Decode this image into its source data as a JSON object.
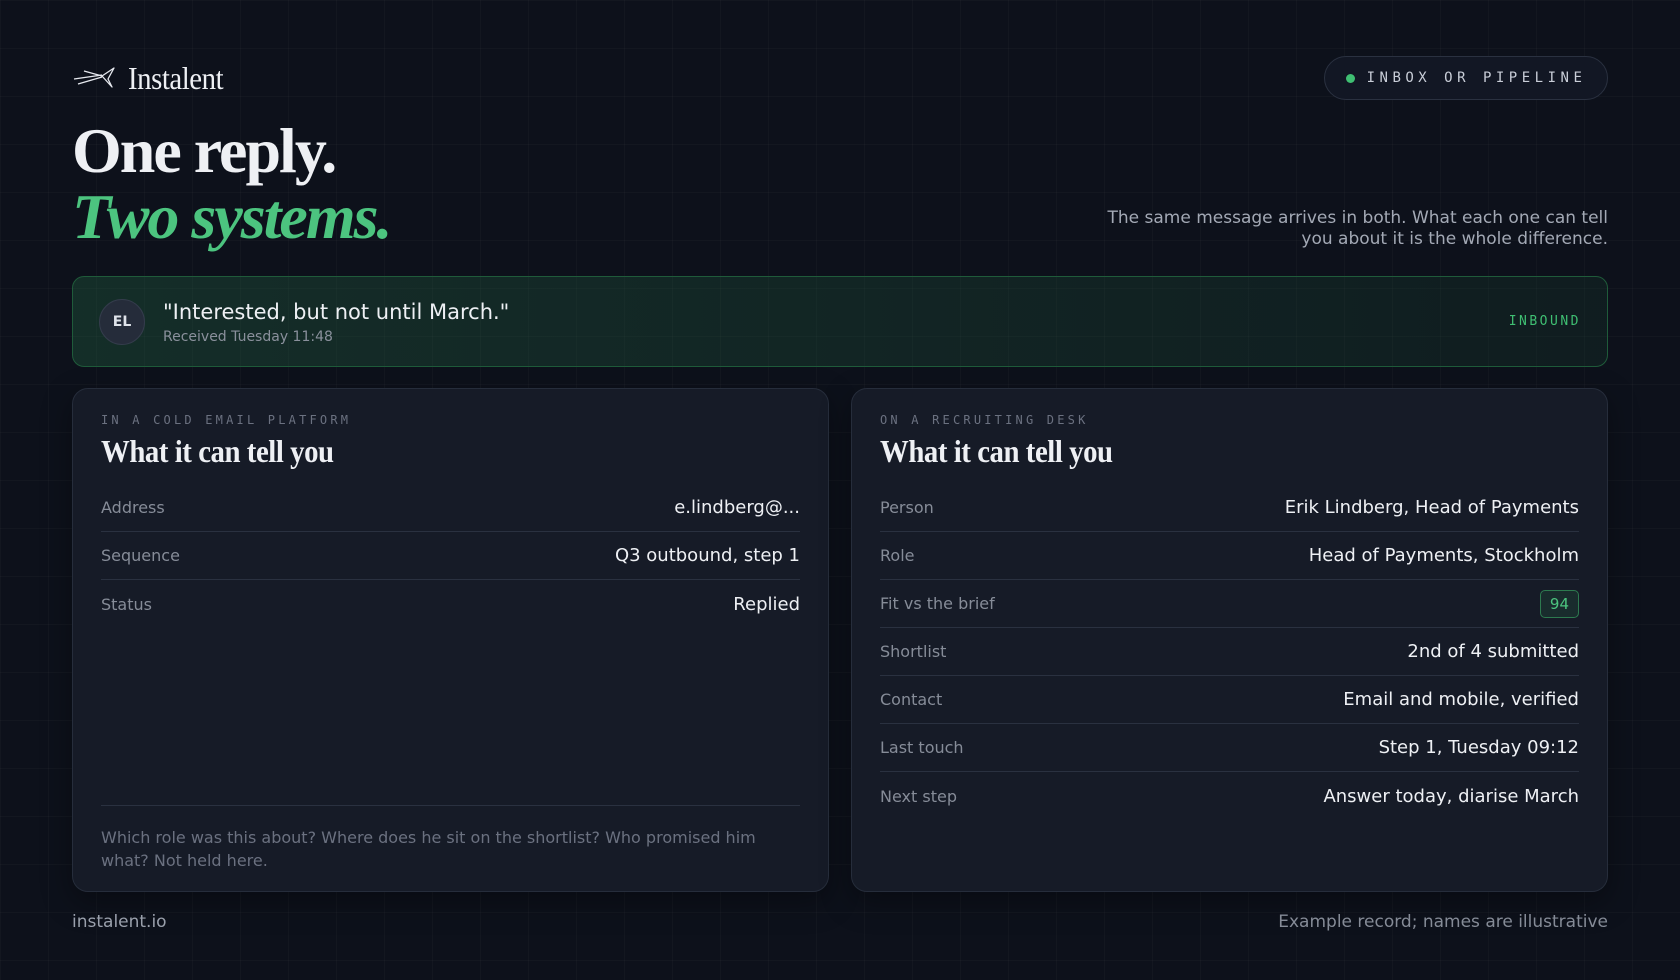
{
  "brand": {
    "name": "Instalent",
    "logo_icon": "sparkle-arrow-icon"
  },
  "header": {
    "pill_label": "INBOX OR PIPELINE",
    "pill_dot_color": "#3fbf72"
  },
  "hero": {
    "headline_line1": "One reply.",
    "headline_line2": "Two systems.",
    "lede": "The same message arrives in both. What each one can tell you about it is the whole difference."
  },
  "message": {
    "avatar_initials": "EL",
    "quote": "\"Interested, but not until March.\"",
    "meta": "Received Tuesday 11:48",
    "badge": "INBOUND"
  },
  "cards": {
    "left": {
      "eyebrow": "IN A COLD EMAIL PLATFORM",
      "title": "What it can tell you",
      "rows": [
        {
          "label": "Address",
          "value": "e.lindberg@..."
        },
        {
          "label": "Sequence",
          "value": "Q3 outbound, step 1"
        },
        {
          "label": "Status",
          "value": "Replied"
        }
      ],
      "note": "Which role was this about? Where does he sit on the shortlist? Who promised him what? Not held here."
    },
    "right": {
      "eyebrow": "ON A RECRUITING DESK",
      "title": "What it can tell you",
      "rows": [
        {
          "label": "Person",
          "value": "Erik Lindberg, Head of Payments"
        },
        {
          "label": "Role",
          "value": "Head of Payments, Stockholm"
        },
        {
          "label": "Fit vs the brief",
          "value": "94"
        },
        {
          "label": "Shortlist",
          "value": "2nd of 4 submitted"
        },
        {
          "label": "Contact",
          "value": "Email and mobile, verified"
        },
        {
          "label": "Last touch",
          "value": "Step 1, Tuesday 09:12"
        },
        {
          "label": "Next step",
          "value": "Answer today, diarise March"
        }
      ]
    }
  },
  "footer": {
    "site": "instalent.io",
    "disclaimer": "Example record; names are illustrative"
  },
  "colors": {
    "accent": "#4cc47f",
    "background": "#0d111b",
    "card": "#161b27"
  }
}
